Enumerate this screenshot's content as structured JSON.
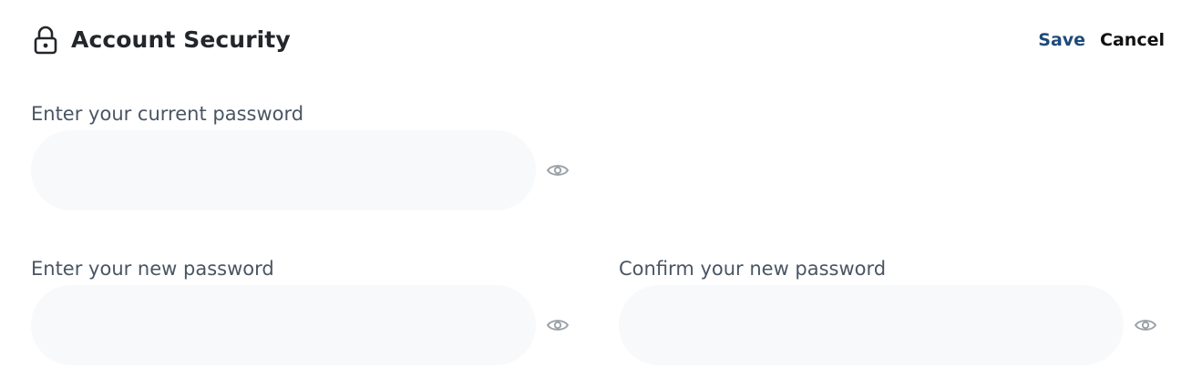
{
  "header": {
    "title": "Account Security",
    "icon": "lock-icon",
    "save_label": "Save",
    "cancel_label": "Cancel"
  },
  "fields": {
    "current_password": {
      "label": "Enter your current password",
      "value": "",
      "placeholder": "",
      "toggle_icon": "eye-icon"
    },
    "new_password": {
      "label": "Enter your new password",
      "value": "",
      "placeholder": "",
      "toggle_icon": "eye-icon"
    },
    "confirm_password": {
      "label": "Confirm your new password",
      "value": "",
      "placeholder": "",
      "toggle_icon": "eye-icon"
    }
  },
  "colors": {
    "save": "#1e4a7a",
    "cancel": "#111111",
    "input_background": "#f8f9fa",
    "label": "#4a5563",
    "icon": "#9aa0a6"
  }
}
